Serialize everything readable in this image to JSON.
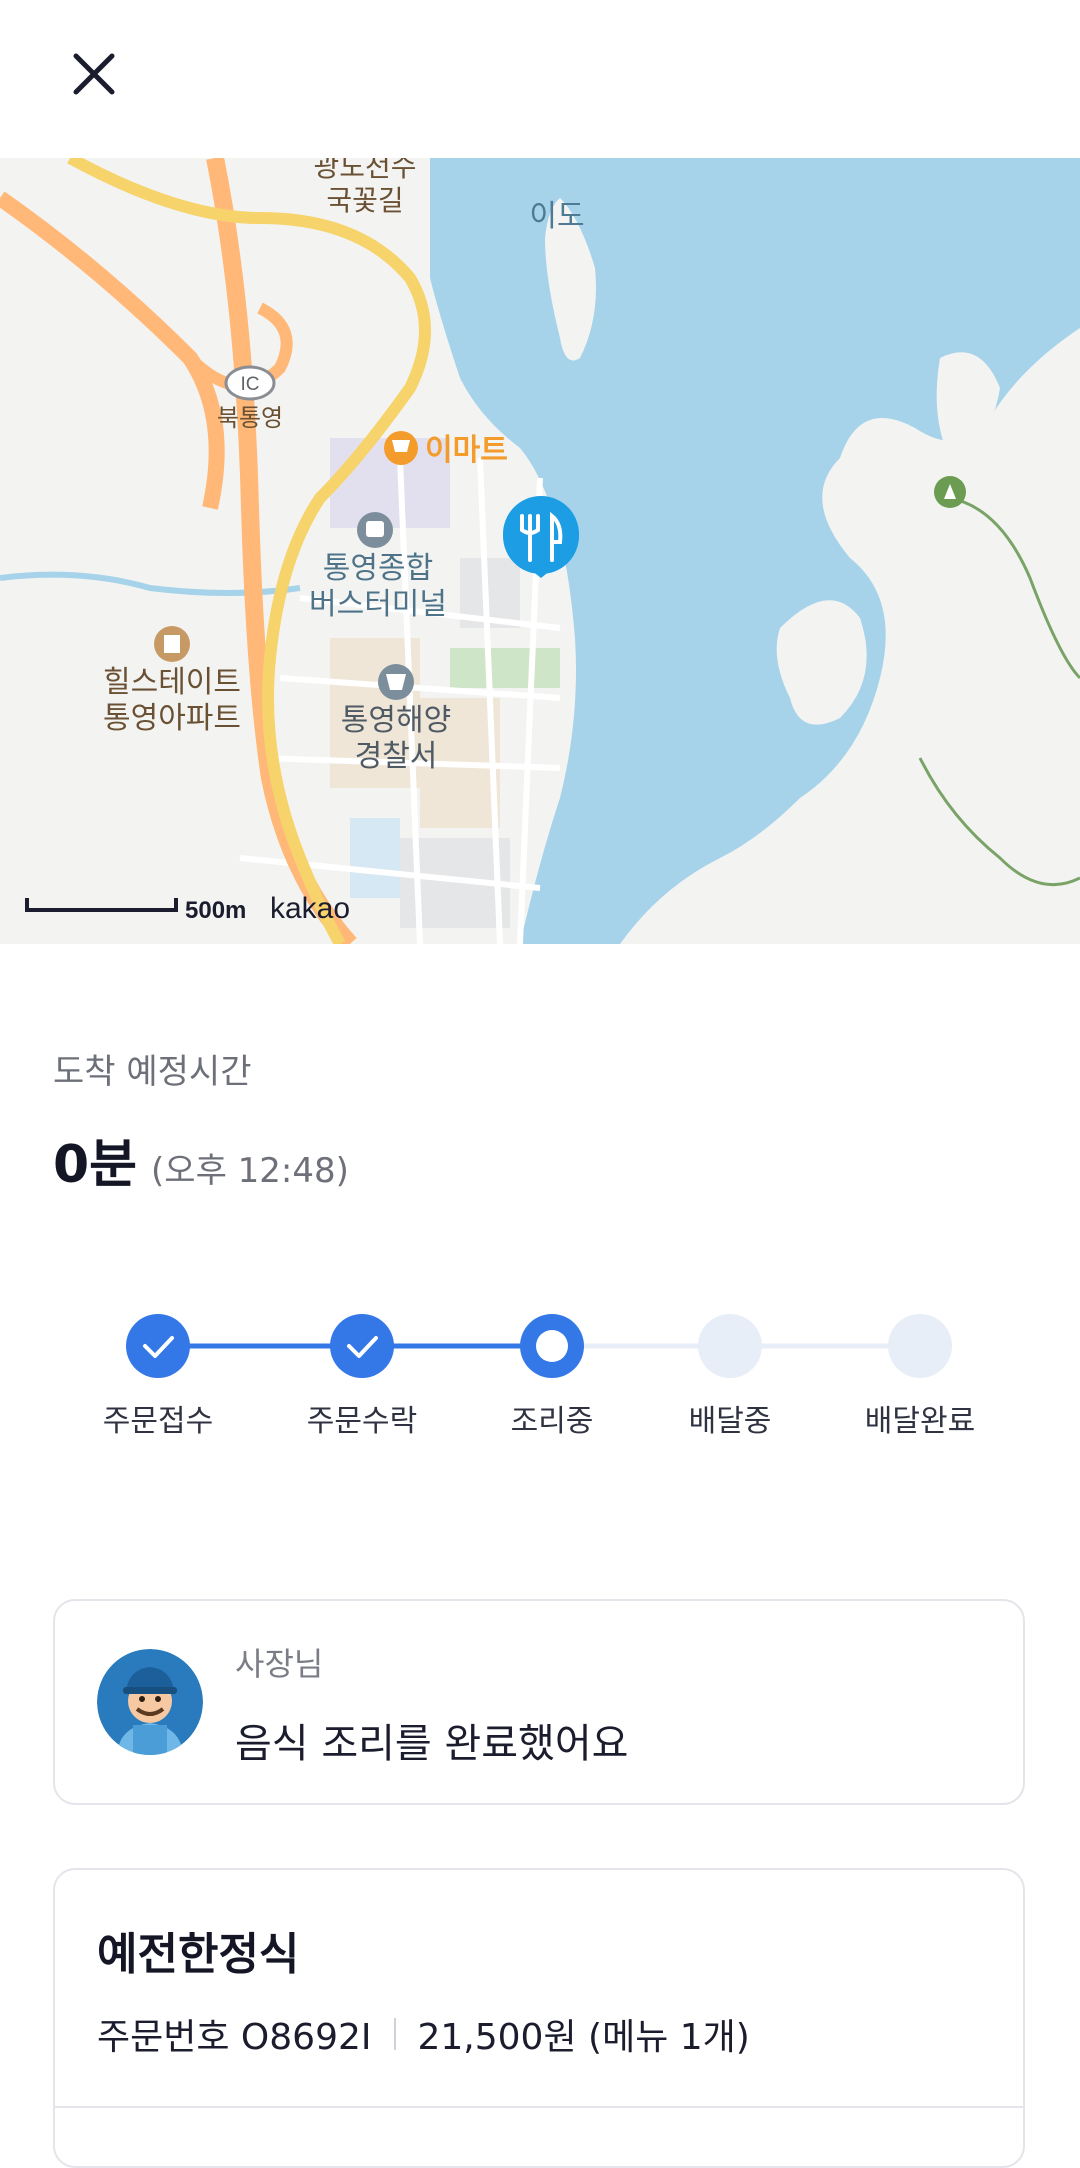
{
  "header": {
    "close_icon": "close-icon"
  },
  "map": {
    "labels": {
      "top_road": "광도천수",
      "top_road2": "국꽃길",
      "island": "이도",
      "ic": "IC",
      "ic_name": "북통영",
      "emart": "이마트",
      "bus1": "통영종합",
      "bus2": "버스터미널",
      "apt1": "힐스테이트",
      "apt2": "통영아파트",
      "police1": "통영해양",
      "police2": "경찰서"
    },
    "scale": "500m",
    "provider": "kakao",
    "marker_icon": "restaurant-fork-knife-icon"
  },
  "eta": {
    "label": "도착 예정시간",
    "minutes": "0분",
    "time": "(오후 12:48)"
  },
  "progress": {
    "steps": [
      "주문접수",
      "주문수락",
      "조리중",
      "배달중",
      "배달완료"
    ],
    "current_index": 2,
    "accent": "#3478e8",
    "inactive": "#e8eef7"
  },
  "owner": {
    "name": "사장님",
    "message": "음식 조리를 완료했어요",
    "avatar_icon": "delivery-owner-avatar"
  },
  "order": {
    "store": "예전한정식",
    "order_number": "주문번호 O8692I",
    "price_summary": "21,500원 (메뉴 1개)"
  }
}
